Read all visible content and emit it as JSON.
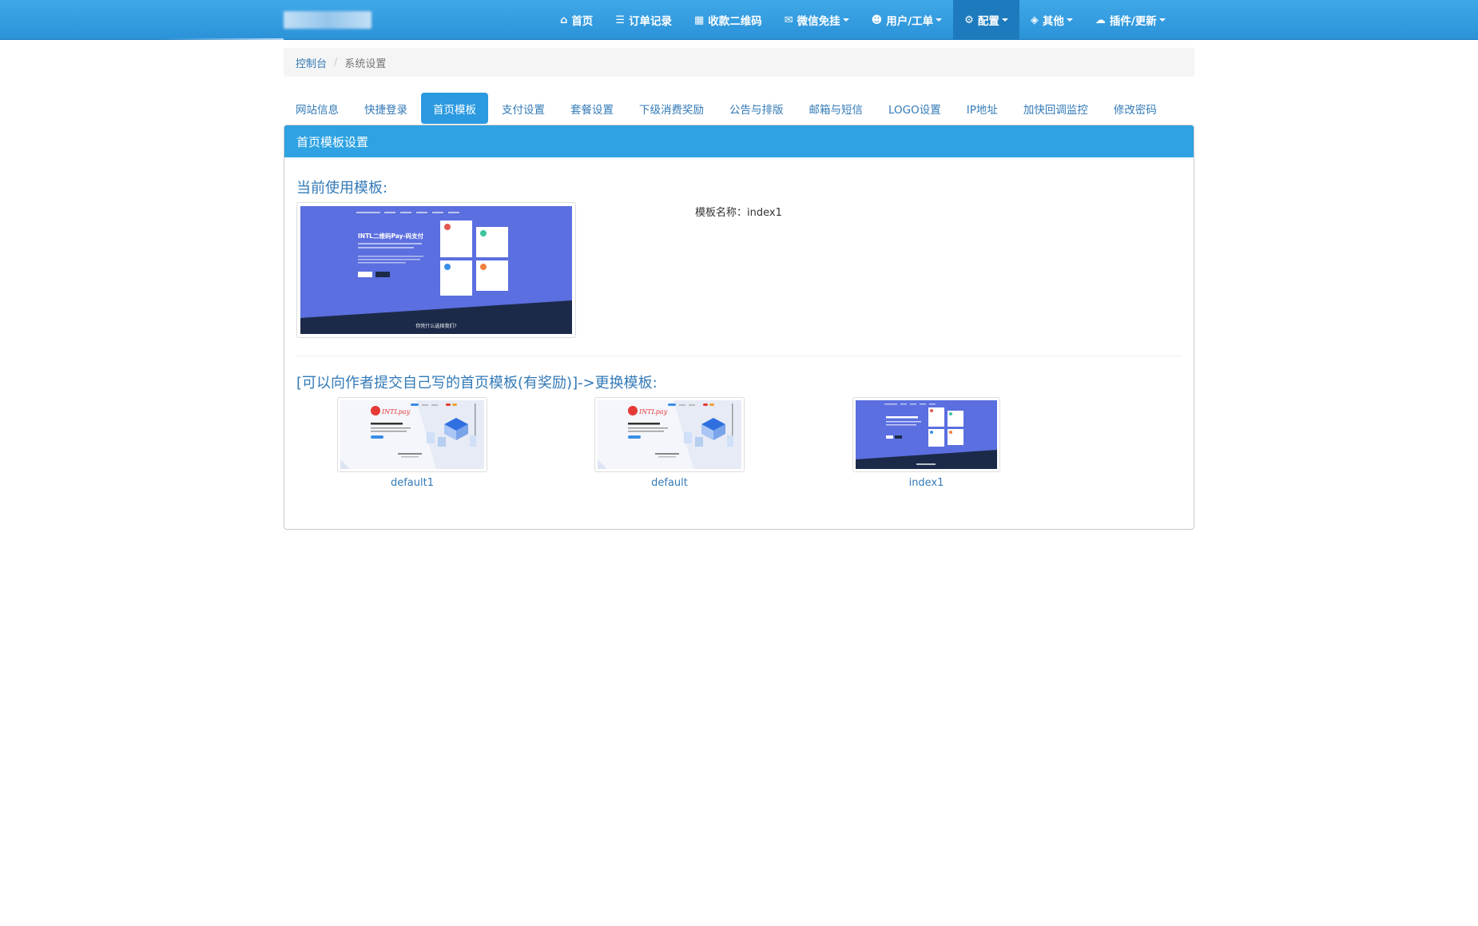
{
  "navbar": {
    "items": [
      {
        "icon": "home-icon",
        "glyph": "⌂",
        "label": "首页"
      },
      {
        "icon": "list-icon",
        "glyph": "☰",
        "label": "订单记录"
      },
      {
        "icon": "qrcode-icon",
        "glyph": "▦",
        "label": "收款二维码"
      },
      {
        "icon": "wechat-icon",
        "glyph": "✉",
        "label": "微信免挂",
        "dropdown": true
      },
      {
        "icon": "user-icon",
        "glyph": "☻",
        "label": "用户/工单",
        "dropdown": true
      },
      {
        "icon": "gear-icon",
        "glyph": "⚙",
        "label": "配置",
        "dropdown": true,
        "active": true
      },
      {
        "icon": "cube-icon",
        "glyph": "◈",
        "label": "其他",
        "dropdown": true
      },
      {
        "icon": "cloud-icon",
        "glyph": "☁",
        "label": "插件/更新",
        "dropdown": true
      }
    ]
  },
  "breadcrumb": {
    "home": "控制台",
    "current": "系统设置"
  },
  "tabs": [
    "网站信息",
    "快捷登录",
    "首页模板",
    "支付设置",
    "套餐设置",
    "下级消费奖励",
    "公告与排版",
    "邮箱与短信",
    "LOGO设置",
    "IP地址",
    "加快回调监控",
    "修改密码"
  ],
  "active_tab": "首页模板",
  "panel": {
    "title": "首页模板设置",
    "current_heading": "当前使用模板:",
    "template_name_label": "模板名称：index1",
    "change_heading": "[可以向作者提交自己写的首页模板(有奖励)]->更换模板:",
    "preview_hero_title": "INTL二维码Pay-码支付",
    "preview_footer_text": "你凭什么选择我们?",
    "preview_brand": "INTLpay",
    "templates": [
      "default1",
      "default",
      "index1"
    ]
  },
  "colors": {
    "navbar": "#2b92d8",
    "panel_heading": "#2ea2e2",
    "link": "#337ab7",
    "preview_blue": "#5b6fe0",
    "preview_dark": "#1c2a4a"
  }
}
